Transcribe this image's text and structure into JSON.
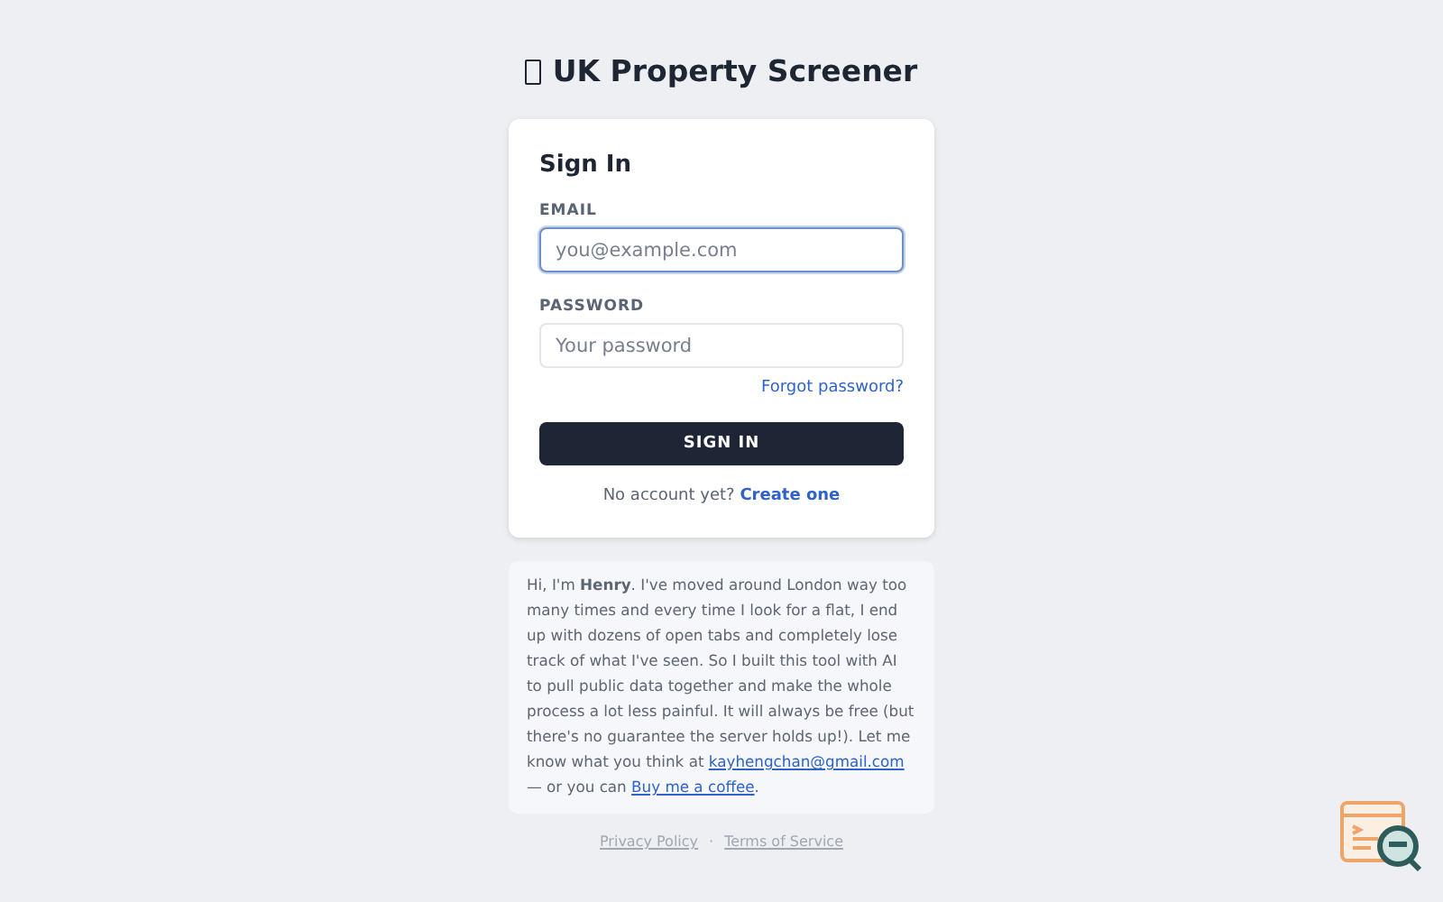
{
  "app_title": "UK Property Screener",
  "sign_in": {
    "heading": "Sign In",
    "fields": [
      {
        "label": "EMAIL",
        "placeholder": "you@example.com",
        "focused": true
      },
      {
        "label": "PASSWORD",
        "placeholder": "Your password",
        "focused": false
      }
    ],
    "forgot_link": "Forgot password?",
    "submit": "SIGN IN",
    "signup_prompt": "No account yet?",
    "signup_link": "Create one"
  },
  "bio": {
    "text": "Hi, I'm **Henry**. I've moved around London way too many times and every time I look for a flat, I end up with dozens of open tabs and completely lose track of what I've seen. So I built this tool with AI to pull public data together and make the whole process a lot less painful. It will always be free (but there's no guarantee the server holds up!). Let me know what you think at",
    "email_link": "kayhengchan@gmail.com",
    "middle": "— or you can",
    "coffee_link": "Buy me a coffee",
    "end": "."
  },
  "footer_links": [
    "Privacy Policy",
    "Terms of Service"
  ],
  "footer_separator": "·"
}
